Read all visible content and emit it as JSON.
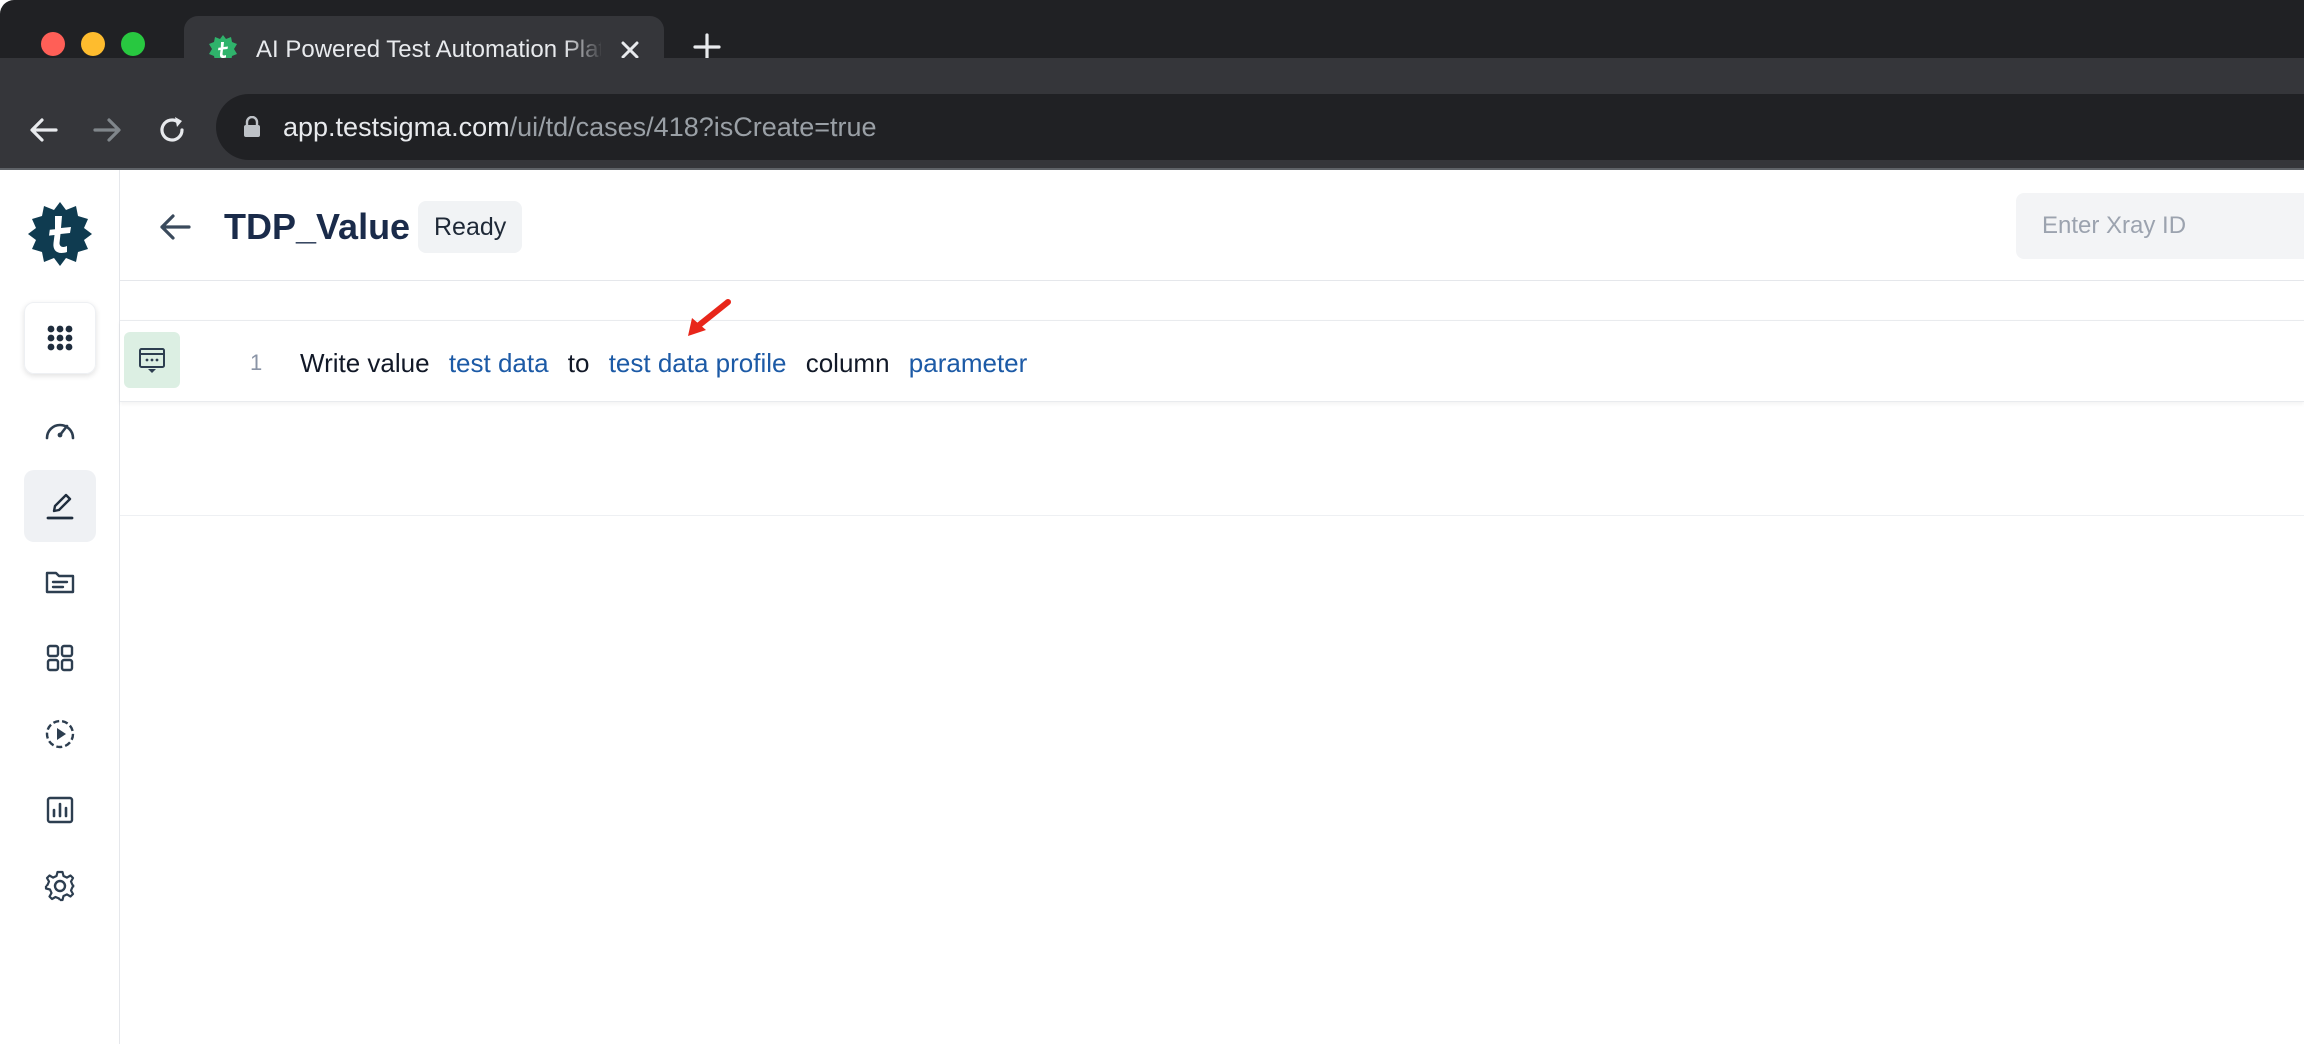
{
  "browser": {
    "tab_title": "AI Powered Test Automation Platform",
    "url_host": "app.testsigma.com",
    "url_path": "/ui/td/cases/418?isCreate=true"
  },
  "header": {
    "title": "TDP_Value",
    "status": "Ready",
    "xray_placeholder": "Enter Xray ID"
  },
  "steps": [
    {
      "number": "1",
      "tokens": [
        "Write value",
        "test data",
        "to",
        "test data profile",
        "column",
        "parameter"
      ]
    }
  ],
  "sidebar": {
    "icons": [
      "apps-grid-icon",
      "dashboard-icon",
      "edit-cases-icon",
      "files-icon",
      "modules-icon",
      "runs-icon",
      "reports-icon",
      "settings-icon"
    ]
  },
  "colors": {
    "brand": "#0f3b50",
    "link": "#1c5aa6",
    "step_type_bg": "#dcefe3",
    "annotation": "#e8261a"
  }
}
